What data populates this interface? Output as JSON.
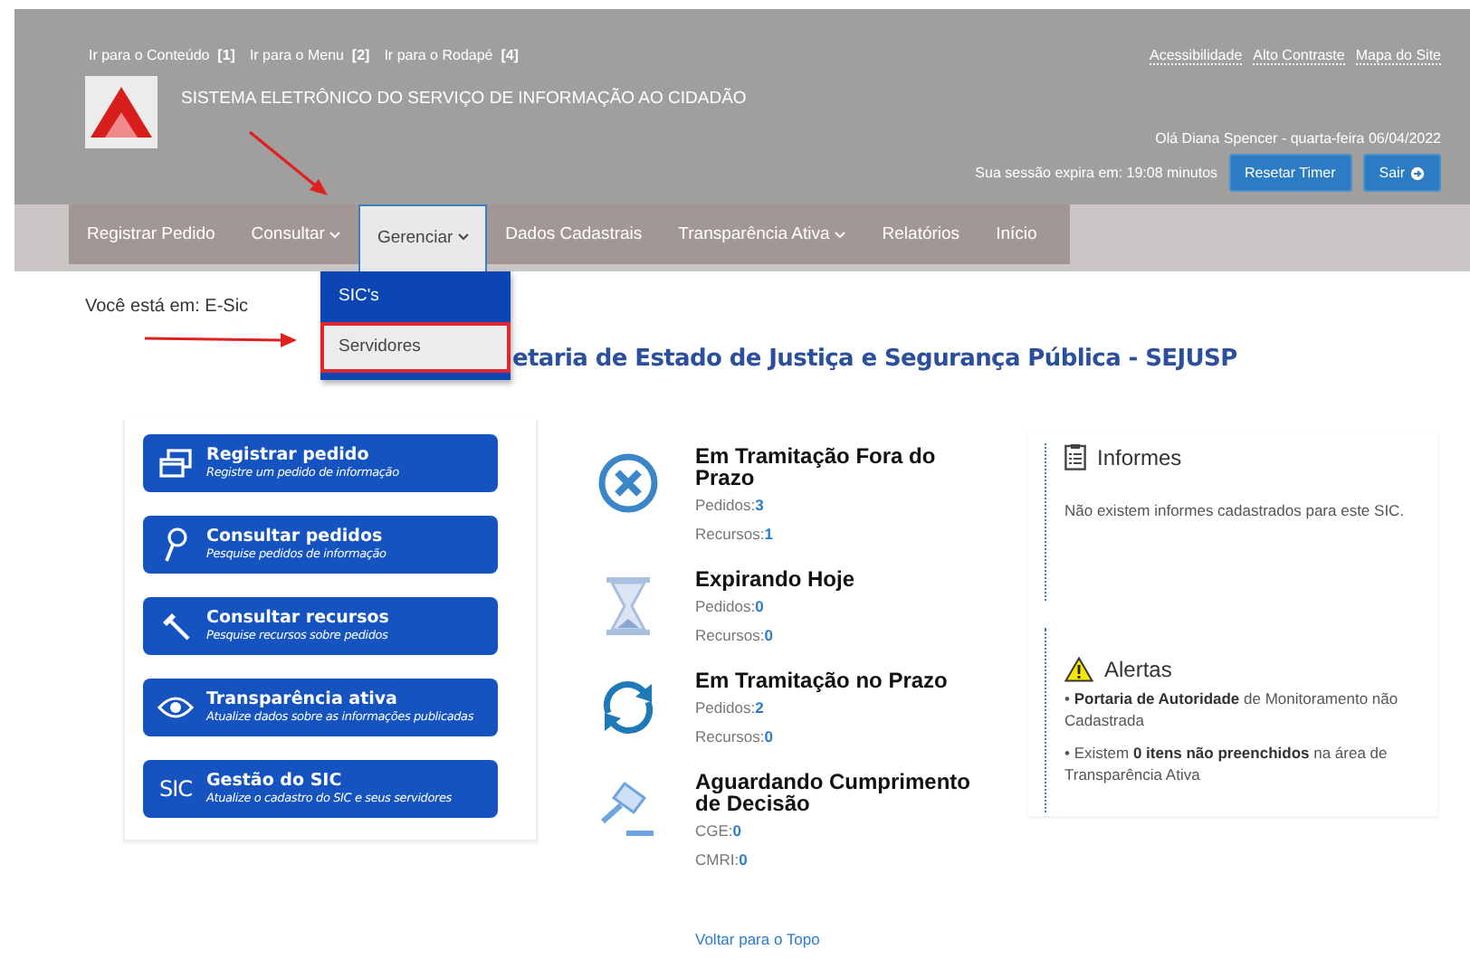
{
  "skip_links": [
    {
      "label": "Ir para o Conteúdo",
      "key": "[1]"
    },
    {
      "label": "Ir para o Menu",
      "key": "[2]"
    },
    {
      "label": "Ir para o Rodapé",
      "key": "[4]"
    }
  ],
  "top_links": [
    "Acessibilidade",
    "Alto Contraste",
    "Mapa do Site"
  ],
  "system_title": "SISTEMA ELETRÔNICO DO SERVIÇO DE INFORMAÇÃO AO CIDADÃO",
  "user_greeting": "Olá Diana Spencer - quarta-feira 06/04/2022",
  "session": {
    "label": "Sua sessão expira em: 19:08 minutos",
    "reset_button": "Resetar Timer",
    "exit_button": "Sair"
  },
  "nav": [
    {
      "label": "Registrar Pedido",
      "dropdown": false,
      "selected": false
    },
    {
      "label": "Consultar",
      "dropdown": true,
      "selected": false
    },
    {
      "label": "Gerenciar",
      "dropdown": true,
      "selected": true
    },
    {
      "label": "Dados Cadastrais",
      "dropdown": false,
      "selected": false
    },
    {
      "label": "Transparência Ativa",
      "dropdown": true,
      "selected": false
    },
    {
      "label": "Relatórios",
      "dropdown": false,
      "selected": false
    },
    {
      "label": "Início",
      "dropdown": false,
      "selected": false
    }
  ],
  "submenu": [
    {
      "label": "SIC's",
      "selected": false
    },
    {
      "label": "Servidores",
      "selected": true
    }
  ],
  "breadcrumb": "Você está em: E-Sic",
  "page_title": "etaria de Estado de Justiça e Segurança Pública - SEJUSP",
  "actions": [
    {
      "kind": "windows",
      "title": "Registrar pedido",
      "subtitle": "Registre um pedido de informação"
    },
    {
      "kind": "search",
      "title": "Consultar pedidos",
      "subtitle": "Pesquise pedidos de informação"
    },
    {
      "kind": "hammer",
      "title": "Consultar recursos",
      "subtitle": "Pesquise recursos sobre pedidos"
    },
    {
      "kind": "eye",
      "title": "Transparência ativa",
      "subtitle": "Atualize dados sobre as informações publicadas"
    },
    {
      "kind": "sic",
      "icon_text": "SIC",
      "title": "Gestão do SIC",
      "subtitle": "Atualize o cadastro do SIC e seus servidores"
    }
  ],
  "statuses": [
    {
      "kind": "overdue",
      "title": "Em Tramitação Fora do Prazo",
      "counts": [
        {
          "label": "Pedidos:",
          "value": "3"
        },
        {
          "label": "Recursos:",
          "value": "1"
        }
      ]
    },
    {
      "kind": "hourglass",
      "title": "Expirando Hoje",
      "counts": [
        {
          "label": "Pedidos:",
          "value": "0"
        },
        {
          "label": "Recursos:",
          "value": "0"
        }
      ]
    },
    {
      "kind": "cycle",
      "title": "Em Tramitação no Prazo",
      "counts": [
        {
          "label": "Pedidos:",
          "value": "2"
        },
        {
          "label": "Recursos:",
          "value": "0"
        }
      ]
    },
    {
      "kind": "gavel",
      "title": "Aguardando Cumprimento de Decisão",
      "counts": [
        {
          "label": "CGE:",
          "value": "0"
        },
        {
          "label": "CMRI:",
          "value": "0"
        }
      ]
    }
  ],
  "back_to_top": "Voltar para o Topo",
  "informes": {
    "title": "Informes",
    "text": "Não existem informes cadastrados para este SIC."
  },
  "alertas": {
    "title": "Alertas",
    "items": [
      "• **Portaria de Autoridade** de Monitoramento não Cadastrada",
      "• Existem **0 itens não preenchidos** na área de Transparência Ativa"
    ]
  }
}
